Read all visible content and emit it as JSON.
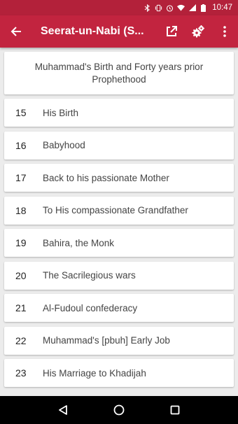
{
  "status_bar": {
    "time": "10:47",
    "icons": [
      "bluetooth-icon",
      "vibrate-icon",
      "alarm-icon",
      "wifi-icon",
      "signal-icon",
      "battery-icon"
    ]
  },
  "app_bar": {
    "title": "Seerat-un-Nabi (S...",
    "back_icon": "arrow-back-icon",
    "actions": [
      "open-external-icon",
      "settings-gears-icon",
      "more-vert-icon"
    ],
    "color": "#c2243f"
  },
  "header": {
    "text": "Muhammad's Birth and Forty years prior Prophethood"
  },
  "chapters": [
    {
      "num": "15",
      "title": "His Birth"
    },
    {
      "num": "16",
      "title": "Babyhood"
    },
    {
      "num": "17",
      "title": "Back to his passionate Mother"
    },
    {
      "num": "18",
      "title": "To His compassionate Grandfather"
    },
    {
      "num": "19",
      "title": "Bahira, the Monk"
    },
    {
      "num": "20",
      "title": "The Sacrilegious wars"
    },
    {
      "num": "21",
      "title": "Al-Fudoul confederacy"
    },
    {
      "num": "22",
      "title": "Muhammad's [pbuh] Early Job"
    },
    {
      "num": "23",
      "title": "His Marriage to Khadijah"
    }
  ],
  "nav_bar": {
    "icons": [
      "nav-back-icon",
      "nav-home-icon",
      "nav-recents-icon"
    ]
  }
}
